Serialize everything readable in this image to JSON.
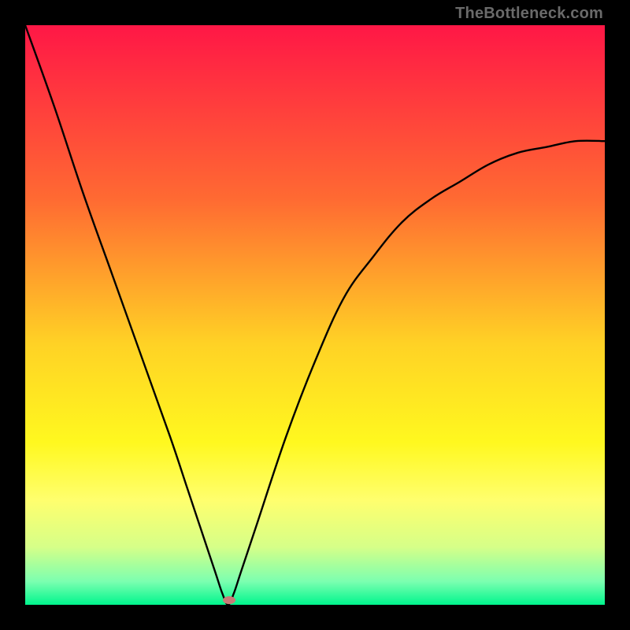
{
  "attribution": "TheBottleneck.com",
  "chart_data": {
    "type": "line",
    "title": "",
    "xlabel": "",
    "ylabel": "",
    "xlim": [
      0,
      100
    ],
    "ylim": [
      0,
      100
    ],
    "curve": {
      "x": [
        0,
        5,
        10,
        15,
        20,
        25,
        28,
        30,
        32,
        33,
        34,
        35,
        36,
        37,
        38,
        40,
        45,
        50,
        55,
        60,
        65,
        70,
        75,
        80,
        85,
        90,
        95,
        100
      ],
      "y": [
        100,
        86,
        71,
        57,
        43,
        29,
        20,
        14,
        8,
        5,
        2,
        0,
        2,
        5,
        8,
        14,
        29,
        42,
        53,
        60,
        66,
        70,
        73,
        76,
        78,
        79,
        80,
        80
      ]
    },
    "marker": {
      "x": 35.2,
      "y": 0.8,
      "color": "#c97b78"
    },
    "background_gradient": {
      "stops": [
        {
          "offset": 0.0,
          "color": "#ff1746"
        },
        {
          "offset": 0.3,
          "color": "#ff6a32"
        },
        {
          "offset": 0.55,
          "color": "#ffd225"
        },
        {
          "offset": 0.72,
          "color": "#fff81f"
        },
        {
          "offset": 0.82,
          "color": "#ffff6e"
        },
        {
          "offset": 0.9,
          "color": "#d6ff88"
        },
        {
          "offset": 0.96,
          "color": "#7bffb0"
        },
        {
          "offset": 1.0,
          "color": "#00f58d"
        }
      ]
    }
  }
}
